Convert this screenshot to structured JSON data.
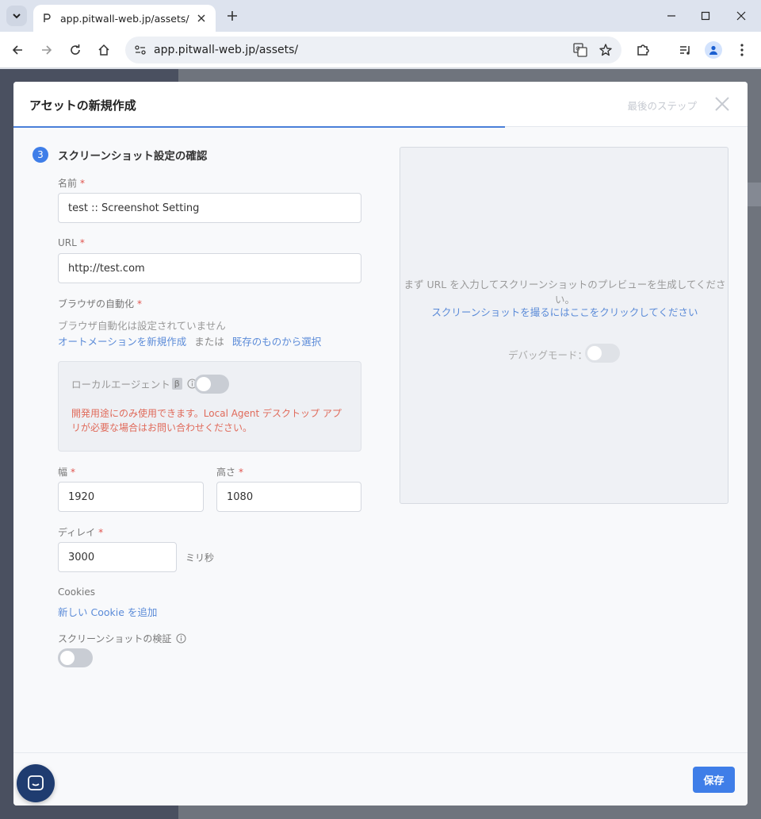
{
  "browser": {
    "tab_title": "app.pitwall-web.jp/assets/",
    "url": "app.pitwall-web.jp/assets/"
  },
  "modal": {
    "title": "アセットの新規作成",
    "step_label": "最後のステップ",
    "step_number": "3",
    "section_title": "スクリーンショット設定の確認",
    "name": {
      "label": "名前",
      "required": "*",
      "value": "test :: Screenshot Setting"
    },
    "url": {
      "label": "URL",
      "required": "*",
      "value": "http://test.com"
    },
    "automation": {
      "label": "ブラウザの自動化",
      "required": "*",
      "status": "ブラウザ自動化は設定されていません",
      "create_link": "オートメーションを新規作成",
      "or": "または",
      "select_link": "既存のものから選択"
    },
    "local_agent": {
      "label": "ローカルエージェント",
      "beta": "β",
      "required": "*",
      "warning": "開発用途にのみ使用できます。Local Agent デスクトップ アプリが必要な場合はお問い合わせください。"
    },
    "width": {
      "label": "幅",
      "required": "*",
      "value": "1920"
    },
    "height": {
      "label": "高さ",
      "required": "*",
      "value": "1080"
    },
    "delay": {
      "label": "ディレイ",
      "required": "*",
      "value": "3000",
      "unit": "ミリ秒"
    },
    "cookies": {
      "label": "Cookies",
      "add_link": "新しい Cookie を追加"
    },
    "verify": {
      "label": "スクリーンショットの検証"
    },
    "preview": {
      "message": "まず URL を入力してスクリーンショットのプレビューを生成してください。",
      "capture_link": "スクリーンショットを撮るにはここをクリックしてください",
      "debug_label": "デバッグモード："
    },
    "save_label": "保存"
  }
}
